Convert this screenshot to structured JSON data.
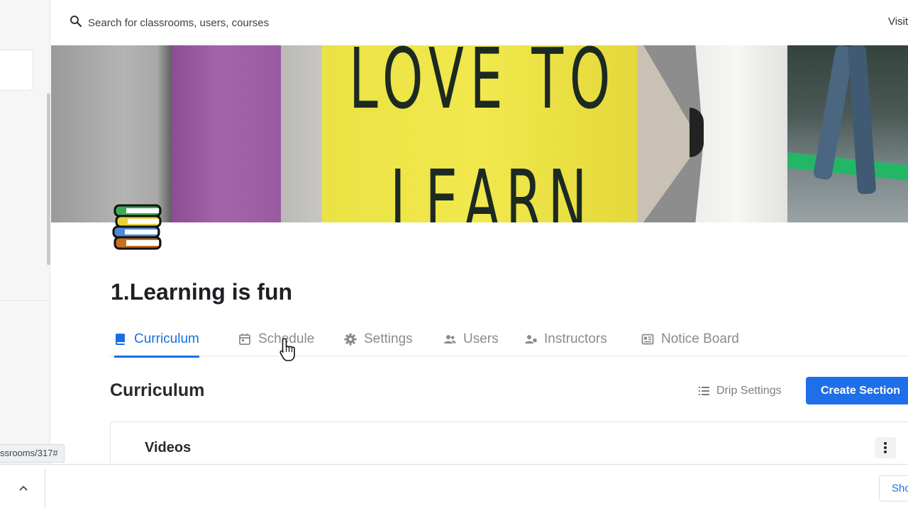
{
  "topbar": {
    "search_placeholder": "Search for classrooms, users, courses",
    "visit_label": "Visit"
  },
  "course": {
    "title": "1.Learning is fun",
    "logo_icon": "books-stack-icon",
    "banner_text_line1": "LOVE TO",
    "banner_text_line2": "LEARN"
  },
  "tabs": [
    {
      "label": "Curriculum",
      "icon": "book-icon",
      "active": true
    },
    {
      "label": "Schedule",
      "icon": "calendar-icon",
      "active": false
    },
    {
      "label": "Settings",
      "icon": "gear-icon",
      "active": false
    },
    {
      "label": "Users",
      "icon": "users-icon",
      "active": false
    },
    {
      "label": "Instructors",
      "icon": "instructors-icon",
      "active": false
    },
    {
      "label": "Notice Board",
      "icon": "notice-board-icon",
      "active": false
    }
  ],
  "curriculum": {
    "title": "Curriculum",
    "drip_settings_label": "Drip Settings",
    "create_section_label": "Create Section",
    "sections": [
      {
        "title": "Videos"
      }
    ]
  },
  "status_url": "ssrooms/317#",
  "download_bar": {
    "show_all_label": "Show all"
  },
  "colors": {
    "accent": "#1a6fe0",
    "primary_button": "#1f6fe8",
    "tab_inactive": "#8a8a90"
  }
}
